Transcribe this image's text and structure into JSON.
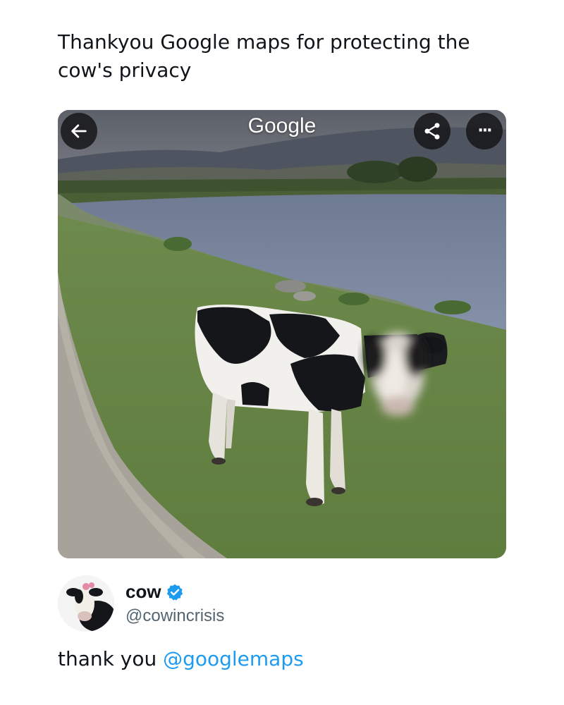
{
  "post": {
    "caption": "Thankyou Google maps for protecting the cow's privacy"
  },
  "photo": {
    "watermark": "Google",
    "back_icon": "arrow-left-icon",
    "share_icon": "share-icon",
    "more_icon": "more-horizontal-icon",
    "more_label": "···"
  },
  "author": {
    "display_name": "cow",
    "handle": "@cowincrisis",
    "verified_icon": "verified-badge-icon",
    "verified_color": "#1d9bf0"
  },
  "tweet": {
    "text": "thank you ",
    "mention": "@googlemaps",
    "mention_color": "#1d9bf0"
  }
}
